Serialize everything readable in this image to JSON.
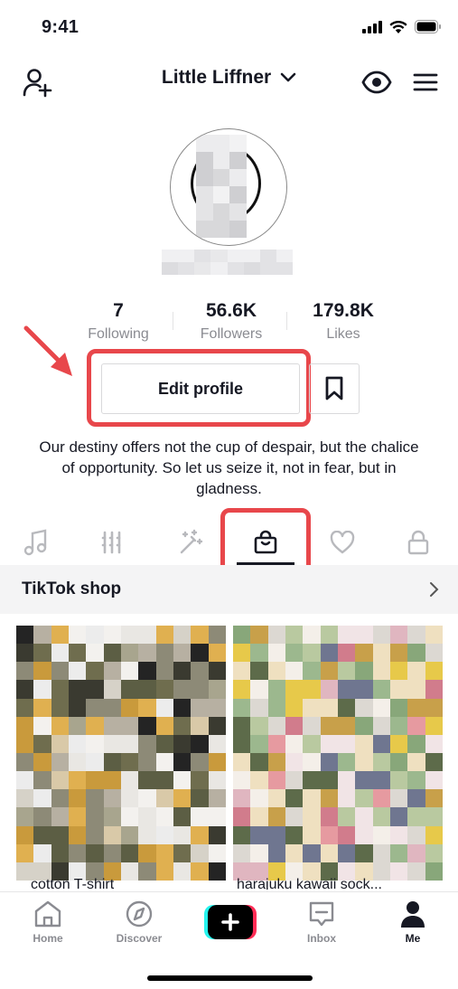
{
  "status_bar": {
    "time": "9:41"
  },
  "header": {
    "title": "Little Liffner",
    "icons": [
      "add-user-icon",
      "chevron-down-icon",
      "eye-icon",
      "menu-icon"
    ]
  },
  "stats": [
    {
      "value": "7",
      "label": "Following"
    },
    {
      "value": "56.6K",
      "label": "Followers"
    },
    {
      "value": "179.8K",
      "label": "Likes"
    }
  ],
  "actions": {
    "edit_profile": "Edit profile"
  },
  "bio": "Our destiny offers not the cup of despair, but the chalice of opportunity. So let us seize it, not in fear, but in gladness.",
  "tabs": [
    "music-icon",
    "grid-icon",
    "magic-icon",
    "shop-bag-icon",
    "heart-icon",
    "lock-icon"
  ],
  "active_tab": "shop-bag-icon",
  "shop": {
    "title": "TikTok shop"
  },
  "products": [
    {
      "title": "cotton T-shirt"
    },
    {
      "title": "harajuku kawaii sock..."
    }
  ],
  "nav": {
    "home": "Home",
    "discover": "Discover",
    "inbox": "Inbox",
    "me": "Me"
  },
  "colors": {
    "highlight": "#e8474b",
    "text": "#161823",
    "muted": "#8a8b91",
    "accent_cyan": "#25f4ee",
    "accent_red": "#fe2c55"
  }
}
